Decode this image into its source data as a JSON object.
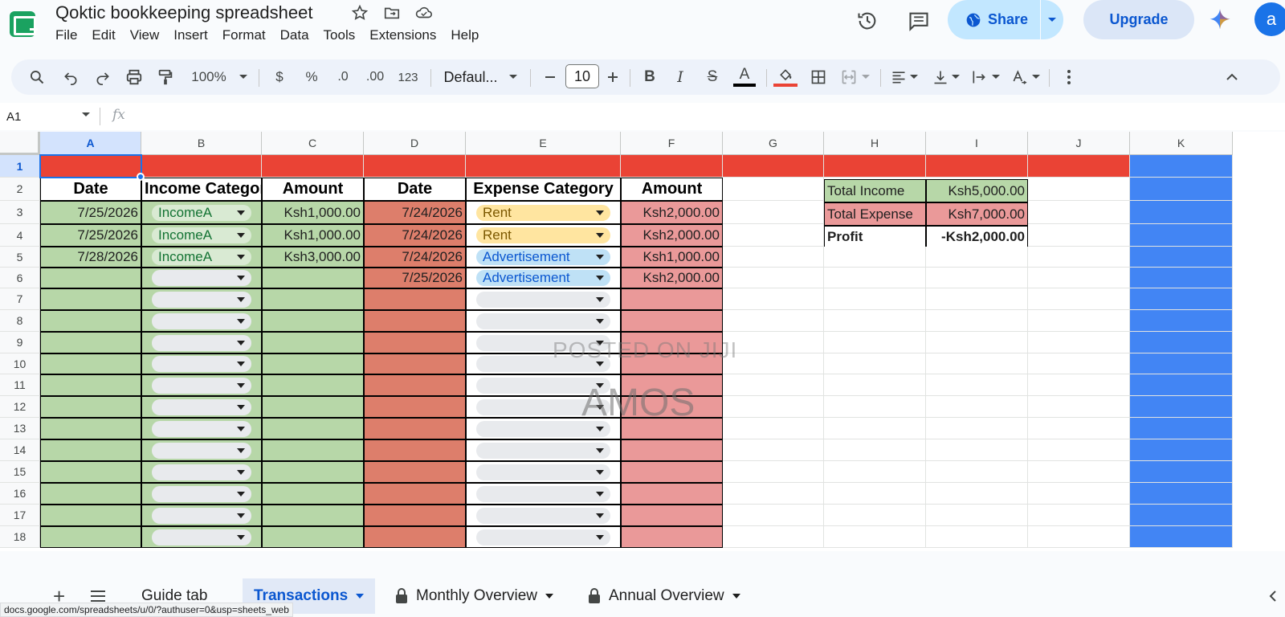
{
  "app": {
    "title": "Qoktic bookkeeping spreadsheet",
    "menu": [
      "File",
      "Edit",
      "View",
      "Insert",
      "Format",
      "Data",
      "Tools",
      "Extensions",
      "Help"
    ],
    "share_label": "Share",
    "upgrade_label": "Upgrade",
    "avatar_letter": "a"
  },
  "toolbar": {
    "zoom": "100%",
    "currency": "$",
    "percent": "%",
    "dec_decrease": ".0",
    "dec_increase": ".00",
    "number_format": "123",
    "font": "Defaul...",
    "font_size": "10",
    "bold": "B",
    "italic": "I",
    "strike": "S",
    "text_color": "A"
  },
  "formula_bar": {
    "cell_ref": "A1",
    "fx": "fx"
  },
  "columns": [
    "A",
    "B",
    "C",
    "D",
    "E",
    "F",
    "G",
    "H",
    "I",
    "J",
    "K"
  ],
  "rows": [
    "1",
    "2",
    "3",
    "4",
    "5",
    "6",
    "7",
    "8",
    "9",
    "10",
    "11",
    "12",
    "13",
    "14",
    "15",
    "16",
    "17",
    "18"
  ],
  "headers": {
    "income_date": "Date",
    "income_category": "Income Categor",
    "income_amount": "Amount",
    "expense_date": "Date",
    "expense_category": "Expense Category",
    "expense_amount": "Amount"
  },
  "income": [
    {
      "date": "7/25/2026",
      "category": "IncomeA",
      "amount": "Ksh1,000.00"
    },
    {
      "date": "7/25/2026",
      "category": "IncomeA",
      "amount": "Ksh1,000.00"
    },
    {
      "date": "7/28/2026",
      "category": "IncomeA",
      "amount": "Ksh3,000.00"
    }
  ],
  "expenses": [
    {
      "date": "7/24/2026",
      "category": "Rent",
      "amount": "Ksh2,000.00"
    },
    {
      "date": "7/24/2026",
      "category": "Rent",
      "amount": "Ksh2,000.00"
    },
    {
      "date": "7/24/2026",
      "category": "Advertisement",
      "amount": "Ksh1,000.00"
    },
    {
      "date": "7/25/2026",
      "category": "Advertisement",
      "amount": "Ksh2,000.00"
    }
  ],
  "summary": {
    "total_income_label": "Total Income",
    "total_income_value": "Ksh5,000.00",
    "total_expense_label": "Total Expense",
    "total_expense_value": "Ksh7,000.00",
    "profit_label": "Profit",
    "profit_value": "-Ksh2,000.00"
  },
  "watermark": {
    "line1": "POSTED ON JIJI",
    "line2": "AMOS"
  },
  "tabs": {
    "guide": "Guide tab",
    "transactions": "Transactions",
    "monthly": "Monthly Overview",
    "annual": "Annual Overview"
  },
  "status_url": "docs.google.com/spreadsheets/u/0/?authuser=0&usp=sheets_web",
  "colors": {
    "income_fill": "#b7d7a8",
    "expense_date_fill": "#dd7e6b",
    "expense_amount_fill": "#ea9999",
    "banner_red": "#ea4335",
    "banner_blue": "#4285f4",
    "chip_income": "#d9ead3",
    "chip_rent": "#ffe5a0",
    "chip_ad": "#bfe1f6",
    "chip_empty": "#e8eaed"
  }
}
